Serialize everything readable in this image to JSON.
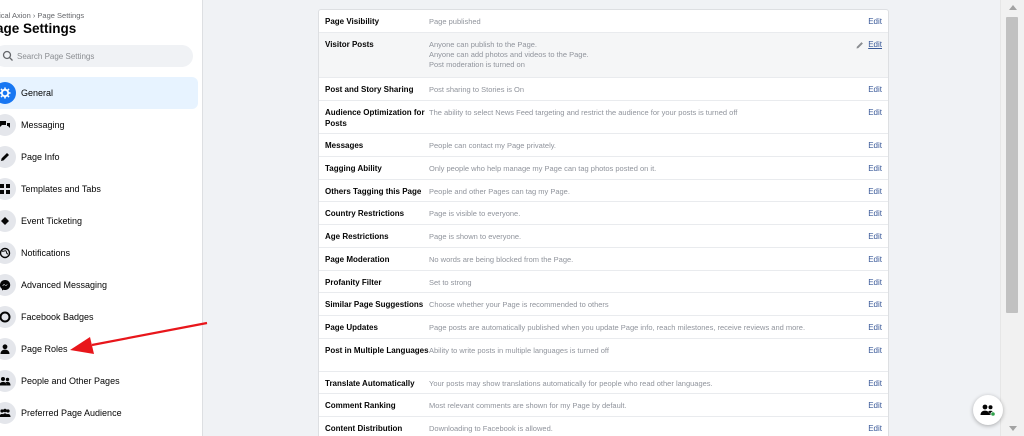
{
  "sidebar": {
    "breadcrumb": "tical Axion › Page Settings",
    "title": "age Settings",
    "search_placeholder": "Search Page Settings",
    "items": [
      {
        "label": "General",
        "icon": "gear-icon",
        "active": true
      },
      {
        "label": "Messaging",
        "icon": "chat-bubbles-icon"
      },
      {
        "label": "Page Info",
        "icon": "pencil-icon"
      },
      {
        "label": "Templates and Tabs",
        "icon": "grid-icon"
      },
      {
        "label": "Event Ticketing",
        "icon": "ticket-icon"
      },
      {
        "label": "Notifications",
        "icon": "globe-icon"
      },
      {
        "label": "Advanced Messaging",
        "icon": "messenger-icon"
      },
      {
        "label": "Facebook Badges",
        "icon": "badge-icon"
      },
      {
        "label": "Page Roles",
        "icon": "person-icon"
      },
      {
        "label": "People and Other Pages",
        "icon": "people-icon"
      },
      {
        "label": "Preferred Page Audience",
        "icon": "audience-icon"
      }
    ]
  },
  "settings": {
    "edit_label": "Edit",
    "rows": [
      {
        "name": "Page Visibility",
        "value": "Page published"
      },
      {
        "name": "Visitor Posts",
        "value": "Anyone can publish to the Page.\nAnyone can add photos and videos to the Page.\nPost moderation is turned on"
      },
      {
        "name": "Post and Story Sharing",
        "value": "Post sharing to Stories is On"
      },
      {
        "name": "Audience Optimization for Posts",
        "value": "The ability to select News Feed targeting and restrict the audience for your posts is turned off"
      },
      {
        "name": "Messages",
        "value": "People can contact my Page privately."
      },
      {
        "name": "Tagging Ability",
        "value": "Only people who help manage my Page can tag photos posted on it."
      },
      {
        "name": "Others Tagging this Page",
        "value": "People and other Pages can tag my Page."
      },
      {
        "name": "Country Restrictions",
        "value": "Page is visible to everyone."
      },
      {
        "name": "Age Restrictions",
        "value": "Page is shown to everyone."
      },
      {
        "name": "Page Moderation",
        "value": "No words are being blocked from the Page."
      },
      {
        "name": "Profanity Filter",
        "value": "Set to strong"
      },
      {
        "name": "Similar Page Suggestions",
        "value": "Choose whether your Page is recommended to others"
      },
      {
        "name": "Page Updates",
        "value": "Page posts are automatically published when you update Page info, reach milestones, receive reviews and more."
      },
      {
        "name": "Post in Multiple Languages",
        "value": "Ability to write posts in multiple languages is turned off"
      },
      {
        "name": "Translate Automatically",
        "value": "Your posts may show translations automatically for people who read other languages."
      },
      {
        "name": "Comment Ranking",
        "value": "Most relevant comments are shown for my Page by default."
      },
      {
        "name": "Content Distribution",
        "value": "Downloading to Facebook is allowed."
      }
    ]
  },
  "colors": {
    "accent": "#1877f2",
    "link": "#385898",
    "annotation": "#e8161b"
  }
}
